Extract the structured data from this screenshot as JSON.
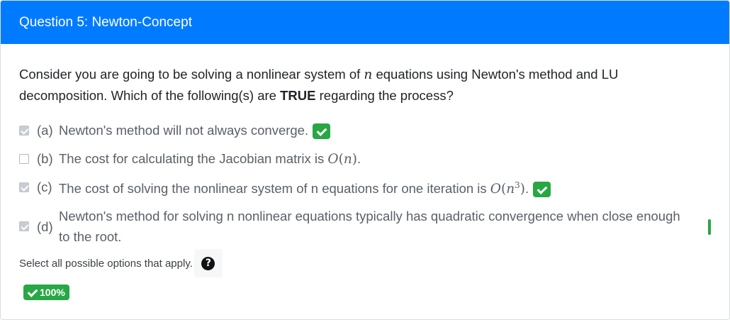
{
  "header": {
    "title": "Question 5: Newton-Concept"
  },
  "question": {
    "text_before": "Consider you are going to be solving a nonlinear system of ",
    "var": "n",
    "text_middle": " equations using Newton's method and LU decomposition. Which of the following(s) are ",
    "emphasis": "TRUE",
    "text_after": " regarding the process?"
  },
  "options": [
    {
      "letter": "(a)",
      "text": "Newton's method will not always converge.",
      "checked": true,
      "correct": true
    },
    {
      "letter": "(b)",
      "text": "The cost for calculating the Jacobian matrix is ",
      "math": "n",
      "checked": false,
      "correct": false
    },
    {
      "letter": "(c)",
      "text": "The cost of solving the nonlinear system of n equations for one iteration is ",
      "math": "n",
      "math_exp": "3",
      "checked": true,
      "correct": true
    },
    {
      "letter": "(d)",
      "text": "Newton's method for solving n nonlinear equations typically has quadratic convergence when close enough to the root.",
      "checked": true,
      "correct": true
    }
  ],
  "help": {
    "text": "Select all possible options that apply.",
    "icon": "question-circle-icon"
  },
  "score": {
    "label": "100%",
    "color": "#28a745"
  },
  "colors": {
    "header": "#007bff",
    "success": "#28a745"
  }
}
